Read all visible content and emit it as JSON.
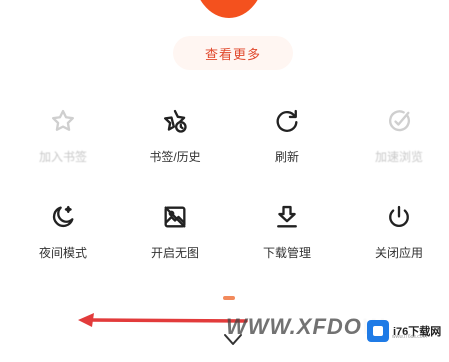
{
  "header": {
    "more_label": "查看更多"
  },
  "menu": {
    "items": [
      {
        "label": "加入书签",
        "icon": "star-outline-icon",
        "dimmed": true
      },
      {
        "label": "书签/历史",
        "icon": "star-clock-icon",
        "dimmed": false
      },
      {
        "label": "刷新",
        "icon": "refresh-icon",
        "dimmed": false
      },
      {
        "label": "加速浏览",
        "icon": "compass-check-icon",
        "dimmed": true
      },
      {
        "label": "夜间模式",
        "icon": "moon-icon",
        "dimmed": false
      },
      {
        "label": "开启无图",
        "icon": "no-image-icon",
        "dimmed": false
      },
      {
        "label": "下载管理",
        "icon": "download-icon",
        "dimmed": false
      },
      {
        "label": "关闭应用",
        "icon": "power-icon",
        "dimmed": false
      }
    ]
  },
  "watermark": {
    "text": "WWW.XFDOW",
    "badge_label": "i76下载网",
    "badge_url": "www.i76ds.com"
  },
  "colors": {
    "accent": "#f4511e",
    "more_text": "#e0482c",
    "arrow": "#e23b3b"
  }
}
